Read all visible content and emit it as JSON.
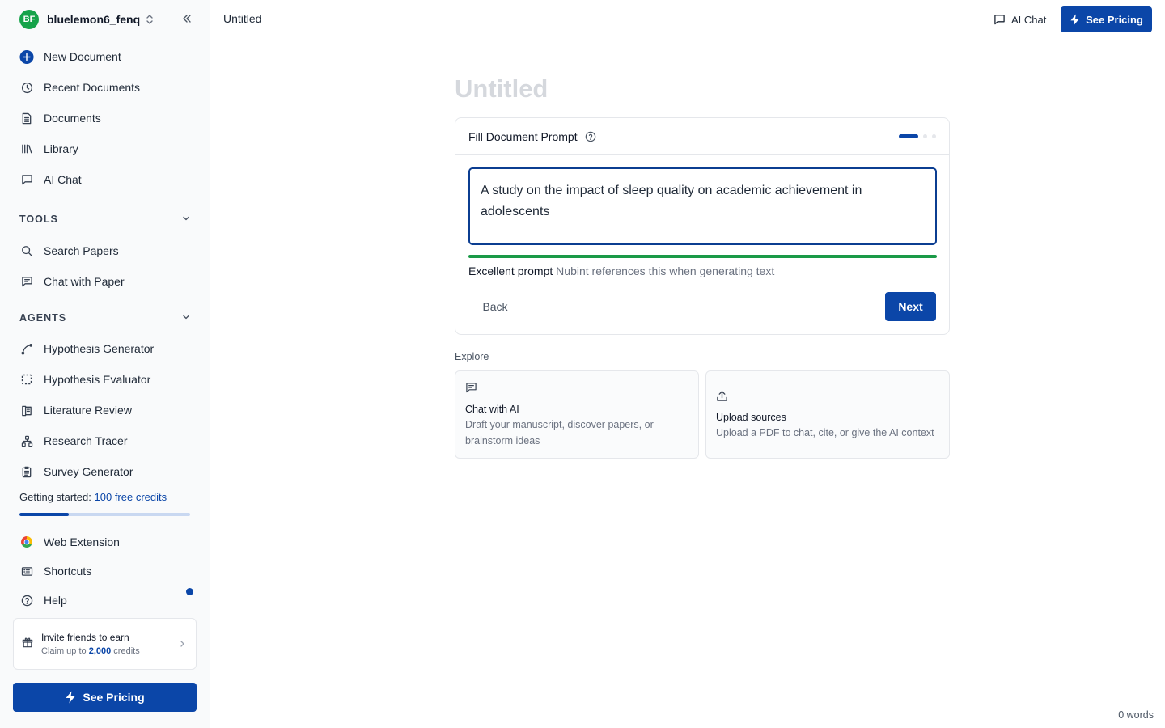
{
  "sidebar": {
    "avatar_initials": "BF",
    "username": "bluelemon6_fenq",
    "main_items": [
      {
        "label": "New Document",
        "icon": "plus-circle-icon"
      },
      {
        "label": "Recent Documents",
        "icon": "clock-icon"
      },
      {
        "label": "Documents",
        "icon": "document-icon"
      },
      {
        "label": "Library",
        "icon": "library-icon"
      },
      {
        "label": "AI Chat",
        "icon": "chat-icon"
      }
    ],
    "tools_heading": "TOOLS",
    "tools": [
      {
        "label": "Search Papers",
        "icon": "search-icon"
      },
      {
        "label": "Chat with Paper",
        "icon": "chat-lines-icon"
      }
    ],
    "agents_heading": "AGENTS",
    "agents": [
      {
        "label": "Hypothesis Generator",
        "icon": "spline-icon"
      },
      {
        "label": "Hypothesis Evaluator",
        "icon": "dashed-square-icon"
      },
      {
        "label": "Literature Review",
        "icon": "literature-icon"
      },
      {
        "label": "Research Tracer",
        "icon": "network-icon"
      },
      {
        "label": "Survey Generator",
        "icon": "clipboard-icon"
      }
    ],
    "credits": {
      "prefix": "Getting started:",
      "link": "100 free credits",
      "progress": 0.29
    },
    "bottom_items": [
      {
        "label": "Web Extension",
        "icon": "chrome-icon"
      },
      {
        "label": "Shortcuts",
        "icon": "keyboard-icon"
      },
      {
        "label": "Help",
        "icon": "help-circle-icon"
      }
    ],
    "invite": {
      "title": "Invite friends to earn",
      "sub_prefix": "Claim up to",
      "sub_amount": "2,000",
      "sub_suffix": "credits"
    },
    "pricing_label": "See Pricing"
  },
  "topbar": {
    "doc_title": "Untitled",
    "ai_chat": "AI Chat",
    "pricing": "See Pricing"
  },
  "main": {
    "title": "Untitled",
    "prompt_card": {
      "heading": "Fill Document Prompt",
      "prompt_text": "A study on the impact of sleep quality on academic achievement in adolescents",
      "quality_label": "Excellent prompt",
      "quality_hint": "Nubint references this when generating text",
      "quality_progress": 1.0,
      "back": "Back",
      "next": "Next"
    },
    "explore": {
      "label": "Explore",
      "cards": [
        {
          "title": "Chat with AI",
          "desc": "Draft your manuscript, discover papers, or brainstorm ideas",
          "icon": "chat-lines-icon"
        },
        {
          "title": "Upload sources",
          "desc": "Upload a PDF to chat, cite, or give the AI context",
          "icon": "upload-icon"
        }
      ]
    },
    "word_count": "0 words"
  },
  "colors": {
    "primary": "#0b46a8",
    "success": "#1a9a47",
    "avatar": "#16a34a"
  }
}
